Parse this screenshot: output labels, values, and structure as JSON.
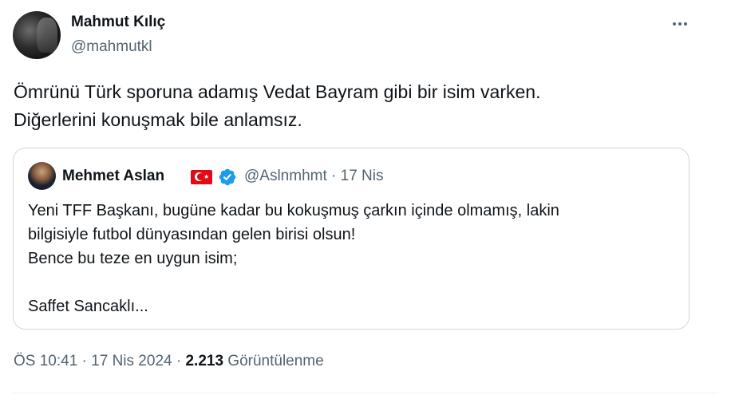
{
  "author": {
    "name": "Mahmut Kılıç",
    "handle": "@mahmutkl"
  },
  "tweet": {
    "lines": [
      "Ömrünü Türk sporuna adamış Vedat Bayram gibi bir isim varken.",
      "Diğerlerini konuşmak bile anlamsız."
    ]
  },
  "quoted": {
    "name": "Mehmet Aslan",
    "handle_date": "@Aslnmhmt · 17 Nis",
    "lines": [
      "Yeni TFF Başkanı, bugüne kadar bu kokuşmuş çarkın içinde olmamış, lakin",
      "bilgisiyle futbol dünyasından gelen birisi olsun!",
      "Bence bu teze en uygun isim;",
      "",
      "Saffet Sancaklı..."
    ]
  },
  "meta": {
    "time": "ÖS 10:41",
    "sep1": " · ",
    "date": "17 Nis 2024",
    "sep2": " · ",
    "views_count": "2.213",
    "views_label": " Görüntülenme"
  },
  "icons": {
    "more": "more-horizontal-icon",
    "verified": "verified-badge-icon",
    "flag": "turkey-flag-icon"
  },
  "colors": {
    "text": "#0f1419",
    "secondary": "#536471",
    "border": "#cfd9de",
    "verified": "#1d9bf0",
    "flag_red": "#e30a17"
  }
}
